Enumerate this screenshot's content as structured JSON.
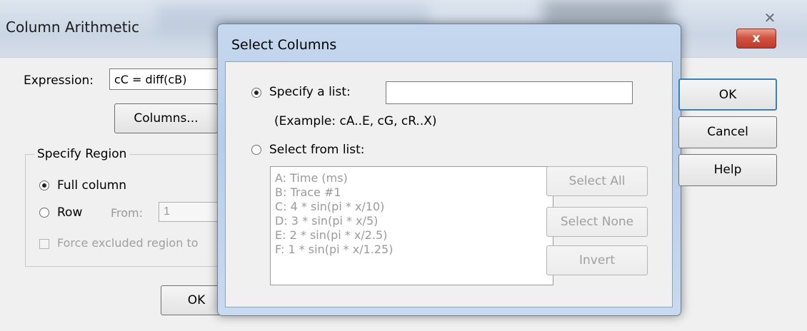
{
  "background_dialog": {
    "title": "Column Arithmetic",
    "expression_label": "Expression:",
    "expression_value": "cC = diff(cB)",
    "columns_button": "Columns...",
    "region_legend": "Specify Region",
    "full_column_label": "Full column",
    "row_label": "Row",
    "from_label": "From:",
    "from_value": "1",
    "force_excluded_label": "Force excluded region to",
    "ok_button": "OK"
  },
  "select_columns": {
    "title": "Select Columns",
    "close_label": "x",
    "specify_list_label": "Specify a list:",
    "specify_list_value": "",
    "example_text": "(Example: cA..E, cG, cR..X)",
    "select_from_list_label": "Select from list:",
    "columns": [
      "A: Time (ms)",
      "B: Trace #1",
      "C: 4 * sin(pi * x/10)",
      "D: 3 * sin(pi * x/5)",
      "E: 2 * sin(pi * x/2.5)",
      "F: 1 * sin(pi * x/1.25)"
    ],
    "select_all_button": "Select All",
    "select_none_button": "Select None",
    "invert_button": "Invert",
    "ok_button": "OK",
    "cancel_button": "Cancel",
    "help_button": "Help",
    "selected_mode": "specify"
  },
  "icons": {
    "close": "close-icon"
  }
}
